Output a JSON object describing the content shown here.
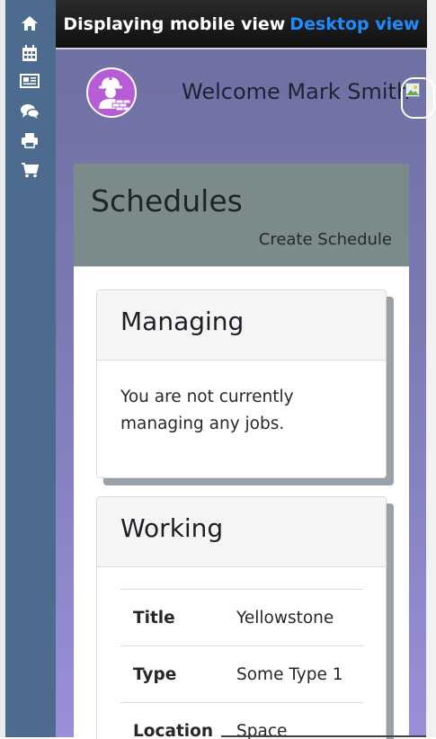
{
  "sidebar": {
    "icons": [
      "home-icon",
      "calendar-icon",
      "newspaper-icon",
      "comments-icon",
      "print-icon",
      "cart-icon"
    ]
  },
  "topbar": {
    "mobile_text": "Displaying mobile view",
    "desktop_link": "Desktop view"
  },
  "user": {
    "welcome": "Welcome Mark Smith"
  },
  "schedules": {
    "title": "Schedules",
    "create_label": "Create Schedule"
  },
  "managing": {
    "title": "Managing",
    "message": "You are not currently managing any jobs."
  },
  "working": {
    "title": "Working",
    "rows": [
      {
        "key": "Title",
        "value": "Yellowstone"
      },
      {
        "key": "Type",
        "value": "Some Type 1"
      },
      {
        "key": "Location",
        "value": "Space"
      }
    ]
  },
  "colors": {
    "sidebar": "#4d6a8f",
    "panel_header": "#7b8a8b",
    "link": "#1f8bff",
    "avatar": "#b75bd6"
  }
}
